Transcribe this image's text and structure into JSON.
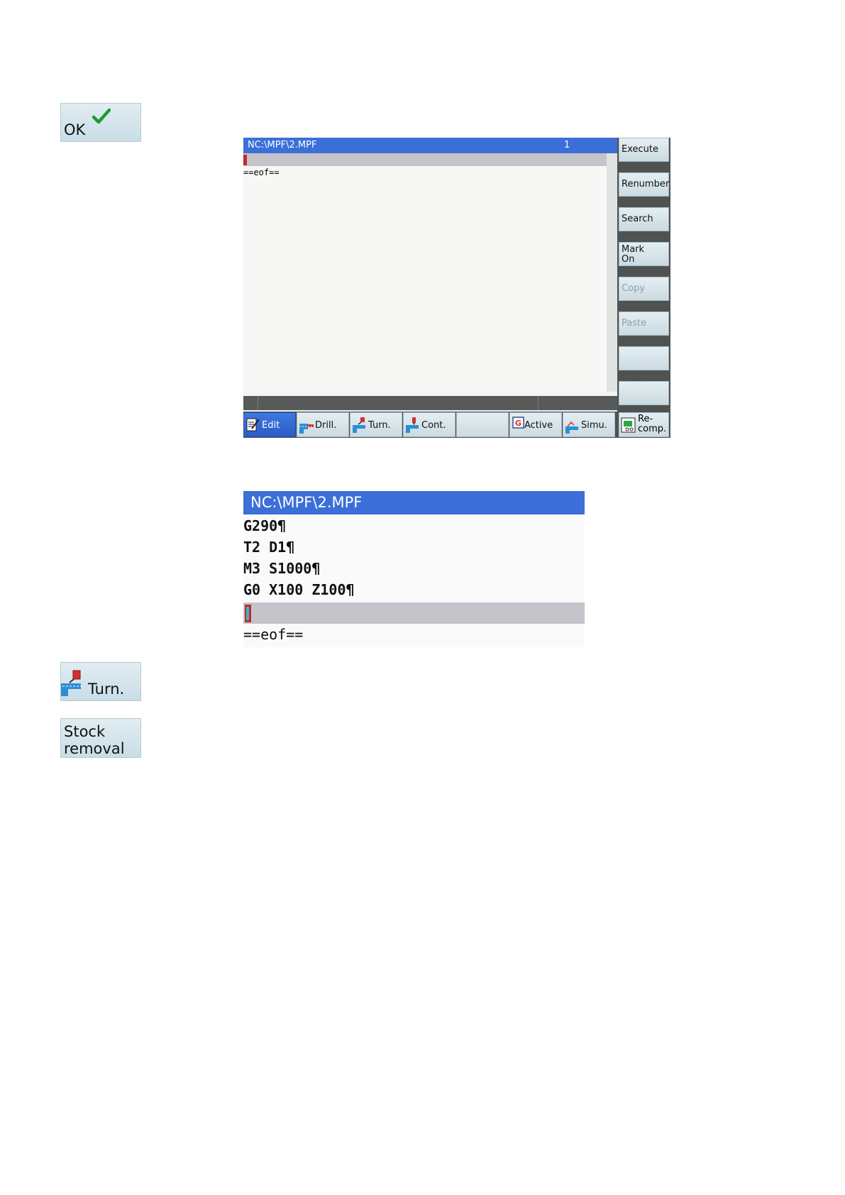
{
  "side_buttons": {
    "ok": {
      "label": "OK"
    },
    "turn": {
      "label": "Turn."
    },
    "stock_removal": {
      "line1": "Stock",
      "line2": "removal"
    }
  },
  "screen1": {
    "title_path": "NC:\\MPF\\2.MPF",
    "title_number": "1",
    "eof_text": "==eof==",
    "vertical_softkeys": [
      {
        "label": "Execute"
      },
      {
        "label": "Renumber"
      },
      {
        "label": "Search"
      },
      {
        "line1": "Mark",
        "line2": "On"
      },
      {
        "label": "Copy"
      },
      {
        "label": "Paste"
      },
      {
        "label": ""
      },
      {
        "label": ""
      }
    ],
    "horizontal_softkeys": [
      {
        "label": "Edit"
      },
      {
        "label": "Drill."
      },
      {
        "label": "Turn."
      },
      {
        "label": "Cont."
      },
      {
        "label": ""
      },
      {
        "label": "Active"
      },
      {
        "label": "Simu."
      }
    ],
    "recomp": {
      "line1": "Re-",
      "line2": "comp."
    }
  },
  "screen2": {
    "title_path": "NC:\\MPF\\2.MPF",
    "lines": [
      "G290¶",
      "T2 D1¶",
      "M3 S1000¶",
      "G0 X100 Z100¶"
    ],
    "eof_text": "==eof=="
  },
  "colors": {
    "title_bar": "#3c6fd8",
    "softkey_bg": "#d6e5ec",
    "cursor_red": "#c62828",
    "cursor_line": "#c4c4ca"
  }
}
